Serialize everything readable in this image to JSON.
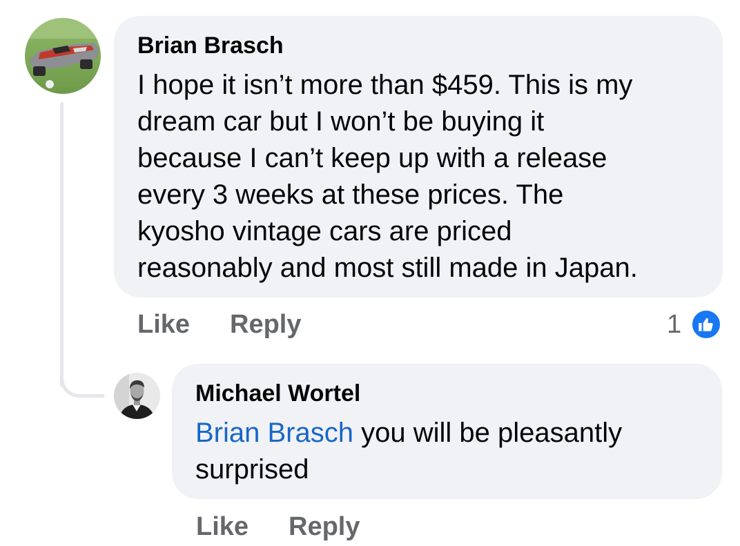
{
  "comment": {
    "author": "Brian Brasch",
    "lines": [
      "I hope it isn’t more than $459. This is my",
      "dream car but I won’t be buying it",
      "because I can’t keep up with a release",
      "every 3 weeks at these prices. The",
      "kyosho vintage cars are priced",
      "reasonably and most still made in Japan."
    ],
    "actions": {
      "like": "Like",
      "reply": "Reply"
    },
    "reaction_count": "1",
    "reaction_icon": "thumbs-up-icon",
    "avatar_icon": "rc-car-photo"
  },
  "reply": {
    "author": "Michael Wortel",
    "mention": "Brian Brasch",
    "text": " you will be pleasantly surprised",
    "actions": {
      "like": "Like",
      "reply": "Reply"
    },
    "avatar_icon": "profile-photo"
  },
  "colors": {
    "bubble": "#f0f2f5",
    "mention": "#1866c7",
    "action_text": "#65676b",
    "reaction_blue": "#1877f2"
  }
}
